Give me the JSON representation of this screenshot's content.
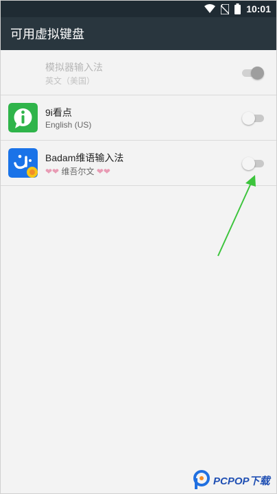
{
  "status_bar": {
    "time": "10:01",
    "icons": [
      "wifi-icon",
      "no-sim-icon",
      "battery-icon"
    ]
  },
  "toolbar": {
    "title": "可用虚拟键盘"
  },
  "keyboards": [
    {
      "title": "模拟器输入法",
      "subtitle": "英文（美国）",
      "enabled": true,
      "disabled_row": true
    },
    {
      "title": "9i看点",
      "subtitle": "English (US)",
      "enabled": false,
      "icon": "9i-app-icon",
      "icon_color": "#2fb44a"
    },
    {
      "title": "Badam维语输入法",
      "subtitle": "维吾尔文",
      "enabled": false,
      "icon": "badam-app-icon",
      "icon_color": "#1a73e8"
    }
  ],
  "annotation": {
    "arrow_color": "#3cc43c"
  },
  "watermark": {
    "text": "PCPOP下载",
    "sub_text": "PCPOP Download"
  }
}
